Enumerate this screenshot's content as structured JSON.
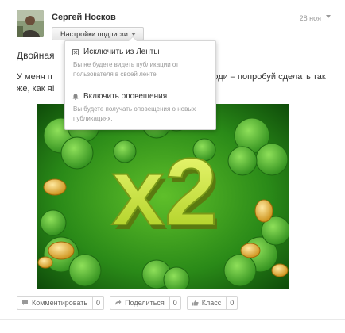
{
  "post": {
    "author": "Сергей Носков",
    "date": "28 ноя",
    "subscription_button": "Настройки подписки",
    "title": "Двойная",
    "text_line1_left": "У меня п",
    "text_line1_right": "ходи – попробуй сделать так",
    "text_line2": "же, как я!",
    "image_text": "x2"
  },
  "dropdown": {
    "items": [
      {
        "label": "Исключить из Ленты",
        "description": "Вы не будете видеть публикации от пользователя в своей ленте",
        "icon": "exclude-feed-icon"
      },
      {
        "label": "Включить оповещения",
        "description": "Вы будете получать оповещения о новых публикациях.",
        "icon": "bell-icon"
      }
    ]
  },
  "actions": [
    {
      "label": "Комментировать",
      "count": "0",
      "icon": "comment-icon"
    },
    {
      "label": "Поделиться",
      "count": "0",
      "icon": "share-icon"
    },
    {
      "label": "Класс",
      "count": "0",
      "icon": "thumbs-up-icon"
    }
  ],
  "colors": {
    "accent_green": "#3f9b1c",
    "image_bg": "#1f6a12",
    "x2_yellow": "#d4e83a"
  }
}
